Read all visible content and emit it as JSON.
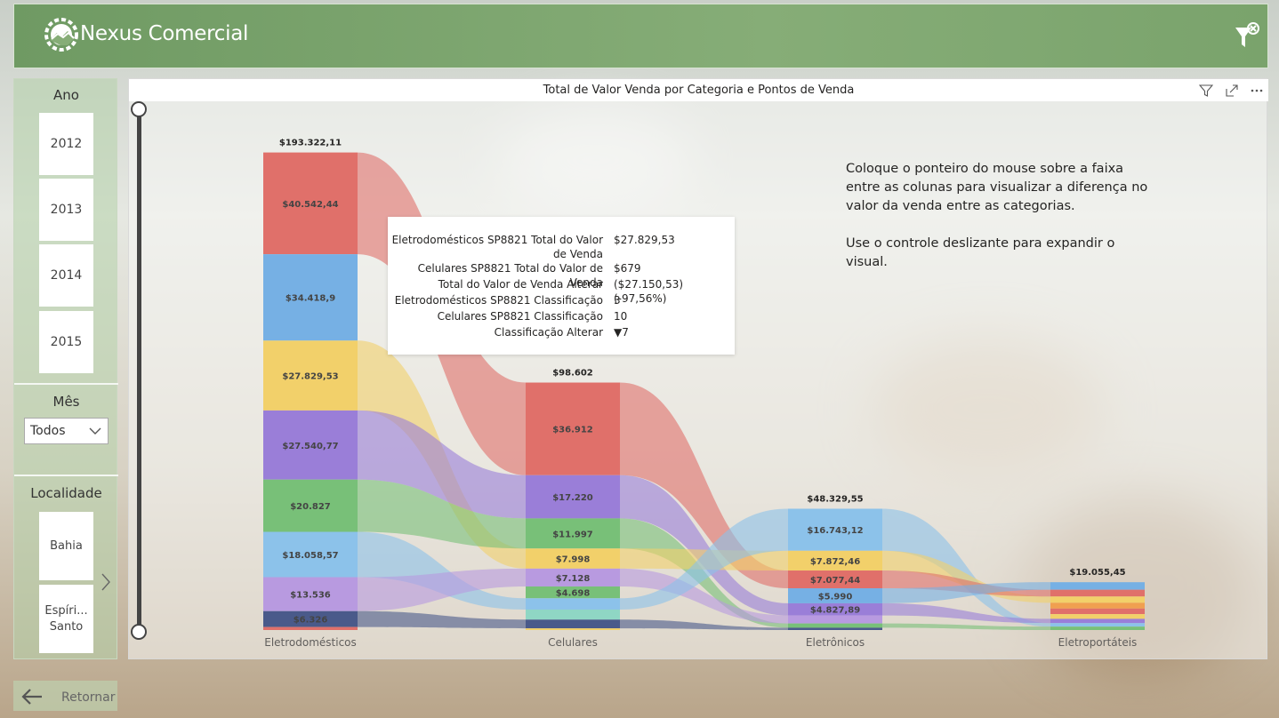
{
  "app": {
    "title": "Nexus Comercial"
  },
  "slicers": {
    "year": {
      "title": "Ano",
      "options": [
        "2012",
        "2013",
        "2014",
        "2015"
      ]
    },
    "month": {
      "title": "Mês",
      "selected": "Todos"
    },
    "location": {
      "title": "Localidade",
      "options": [
        "Bahia",
        "Espíri... Santo"
      ]
    }
  },
  "nav": {
    "back_label": "Retornar"
  },
  "visual": {
    "title": "Total de Valor Venda por Categoria e Pontos de Venda",
    "info_lines": [
      "Coloque o ponteiro do mouse sobre a faixa entre as colunas para visualizar a diferença no valor da venda entre as categorias.",
      "Use o controle deslizante para expandir o visual."
    ]
  },
  "tooltip": {
    "rows": [
      {
        "label": "Eletrodomésticos SP8821 Total do Valor de Venda",
        "value": "$27.829,53"
      },
      {
        "label": "Celulares SP8821 Total do Valor de Venda",
        "value": "$679"
      },
      {
        "label": "Total do Valor de Venda Alterar",
        "value": "($27.150,53) (-97,56%)"
      },
      {
        "label": "Eletrodomésticos SP8821 Classificação",
        "value": "3"
      },
      {
        "label": "Celulares SP8821 Classificação",
        "value": "10"
      },
      {
        "label": "Classificação Alterar",
        "value": "▼7"
      }
    ]
  },
  "colors": {
    "red": "#e0706a",
    "blue": "#76b0e4",
    "yellow": "#f2d06a",
    "purple": "#9a7ed8",
    "green": "#78c078",
    "lightblue": "#8cc2ea",
    "lilac": "#b89ae0",
    "navy": "#4a5a8a",
    "orange": "#f0a050",
    "teal": "#8fd6c4"
  },
  "chart_data": {
    "type": "sankey-ribbon",
    "categories": [
      "Eletrodomésticos",
      "Celulares",
      "Eletrônicos",
      "Eletroportáteis"
    ],
    "totals": [
      "$193.322,11",
      "$98.602",
      "$48.329,55",
      "$19.055,45"
    ],
    "total_values": [
      193322.11,
      98602,
      48329.55,
      19055.45
    ],
    "columns": [
      {
        "category": "Eletrodomésticos",
        "segments": [
          {
            "label": "$40.542,44",
            "value": 40542.44,
            "color": "red"
          },
          {
            "label": "$34.418,9",
            "value": 34418.9,
            "color": "blue"
          },
          {
            "label": "$27.829,53",
            "value": 27829.53,
            "color": "yellow"
          },
          {
            "label": "$27.540,77",
            "value": 27540.77,
            "color": "purple"
          },
          {
            "label": "$20.827",
            "value": 20827,
            "color": "green"
          },
          {
            "label": "$18.058,57",
            "value": 18058.57,
            "color": "lightblue"
          },
          {
            "label": "$13.536",
            "value": 13536,
            "color": "lilac"
          },
          {
            "label": "$6.326",
            "value": 6326,
            "color": "navy"
          },
          {
            "label": "",
            "value": 1200,
            "color": "red"
          }
        ]
      },
      {
        "category": "Celulares",
        "segments": [
          {
            "label": "$36.912",
            "value": 36912,
            "color": "red"
          },
          {
            "label": "$17.220",
            "value": 17220,
            "color": "purple"
          },
          {
            "label": "$11.997",
            "value": 11997,
            "color": "green"
          },
          {
            "label": "$7.998",
            "value": 7998,
            "color": "yellow"
          },
          {
            "label": "$7.128",
            "value": 7128,
            "color": "lilac"
          },
          {
            "label": "$4.698",
            "value": 4698,
            "color": "green"
          },
          {
            "label": "",
            "value": 4500,
            "color": "lightblue"
          },
          {
            "label": "",
            "value": 4000,
            "color": "teal"
          },
          {
            "label": "",
            "value": 3470,
            "color": "navy"
          },
          {
            "label": "",
            "value": 679,
            "color": "yellow"
          }
        ]
      },
      {
        "category": "Eletrônicos",
        "segments": [
          {
            "label": "$16.743,12",
            "value": 16743.12,
            "color": "lightblue"
          },
          {
            "label": "$7.872,46",
            "value": 7872.46,
            "color": "yellow"
          },
          {
            "label": "$7.077,44",
            "value": 7077.44,
            "color": "red"
          },
          {
            "label": "$5.990",
            "value": 5990,
            "color": "blue"
          },
          {
            "label": "$4.827,89",
            "value": 4827.89,
            "color": "purple"
          },
          {
            "label": "",
            "value": 3200,
            "color": "lilac"
          },
          {
            "label": "",
            "value": 1700,
            "color": "green"
          },
          {
            "label": "",
            "value": 918.64,
            "color": "navy"
          }
        ]
      },
      {
        "category": "Eletroportáteis",
        "segments": [
          {
            "label": "",
            "value": 3000,
            "color": "blue"
          },
          {
            "label": "",
            "value": 2700,
            "color": "red"
          },
          {
            "label": "",
            "value": 2500,
            "color": "yellow"
          },
          {
            "label": "",
            "value": 2300,
            "color": "orange"
          },
          {
            "label": "",
            "value": 2200,
            "color": "red"
          },
          {
            "label": "",
            "value": 1900,
            "color": "yellow"
          },
          {
            "label": "",
            "value": 1700,
            "color": "purple"
          },
          {
            "label": "",
            "value": 1400,
            "color": "lightblue"
          },
          {
            "label": "",
            "value": 1355.45,
            "color": "green"
          }
        ]
      }
    ],
    "slider": {
      "min": 0,
      "max": 1
    }
  }
}
